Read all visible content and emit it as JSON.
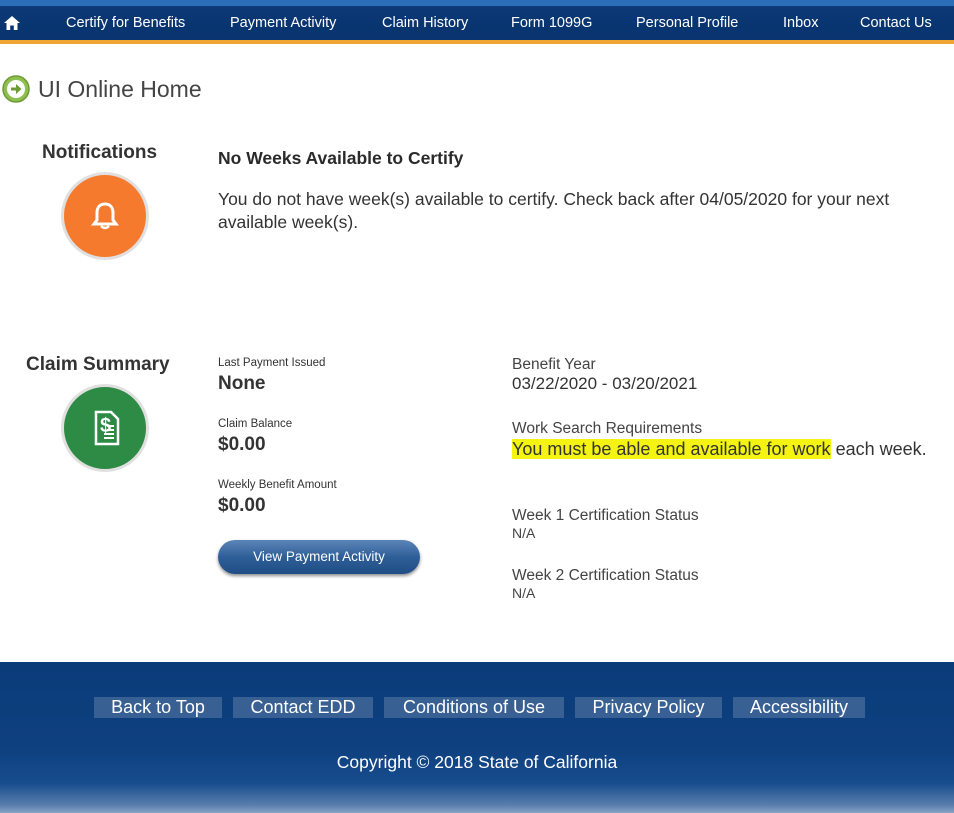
{
  "nav": {
    "home_icon": "home-icon",
    "items": [
      {
        "label": "Certify for Benefits"
      },
      {
        "label": "Payment Activity"
      },
      {
        "label": "Claim History"
      },
      {
        "label": "Form 1099G"
      },
      {
        "label": "Personal Profile"
      },
      {
        "label": "Inbox"
      },
      {
        "label": "Contact Us"
      }
    ]
  },
  "page": {
    "title": "UI Online Home",
    "title_icon": "arrow-right-circle-icon"
  },
  "notifications": {
    "heading": "Notifications",
    "icon": "bell-icon",
    "icon_color": "#f57a2e",
    "title": "No Weeks Available to Certify",
    "message": "You do not have week(s) available to certify. Check back after 04/05/2020 for your next available week(s)."
  },
  "claim_summary": {
    "heading": "Claim Summary",
    "icon": "dollar-document-icon",
    "icon_color": "#2e8b45",
    "last_payment_label": "Last Payment Issued",
    "last_payment_value": "None",
    "claim_balance_label": "Claim Balance",
    "claim_balance_value": "$0.00",
    "weekly_benefit_label": "Weekly Benefit Amount",
    "weekly_benefit_value": "$0.00",
    "view_button": "View Payment Activity",
    "benefit_year_label": "Benefit Year",
    "benefit_year_value": "03/22/2020 - 03/20/2021",
    "work_search_label": "Work Search Requirements",
    "work_search_highlight": "You must be able and available for work",
    "work_search_rest": "each week.",
    "highlight_color": "#f4f312",
    "week1_label": "Week 1 Certification Status",
    "week1_value": "N/A",
    "week2_label": "Week 2 Certification Status",
    "week2_value": "N/A"
  },
  "footer": {
    "links": [
      {
        "label": "Back to Top"
      },
      {
        "label": "Contact EDD"
      },
      {
        "label": "Conditions of Use"
      },
      {
        "label": "Privacy Policy"
      },
      {
        "label": "Accessibility"
      }
    ],
    "copyright": "Copyright © 2018 State of California"
  }
}
